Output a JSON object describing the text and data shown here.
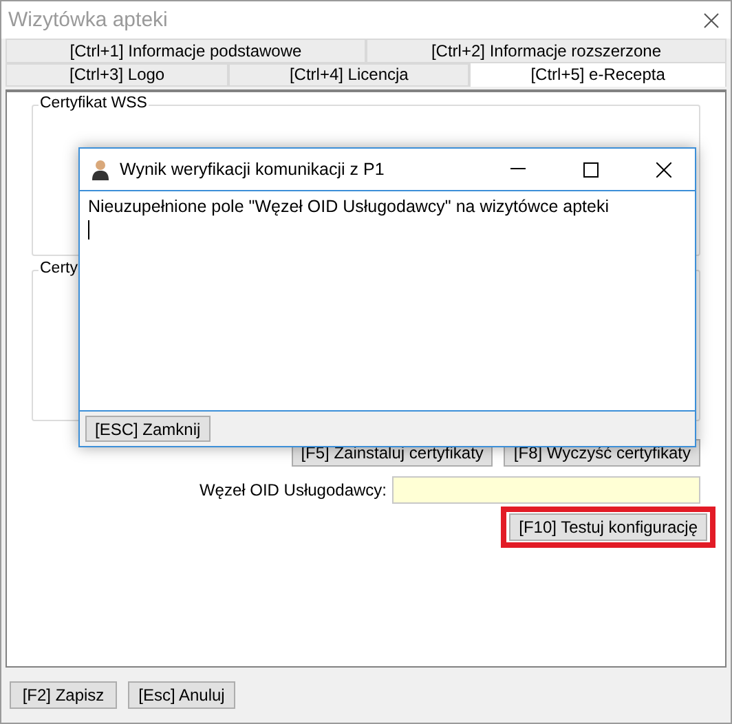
{
  "window": {
    "title": "Wizytówka apteki"
  },
  "tab_rows": [
    [
      {
        "label": "[Ctrl+1] Informacje podstawowe",
        "selected": false
      },
      {
        "label": "[Ctrl+2] Informacje rozszerzone",
        "selected": false
      }
    ],
    [
      {
        "label": "[Ctrl+3] Logo",
        "selected": false
      },
      {
        "label": "[Ctrl+4] Licencja",
        "selected": false
      },
      {
        "label": "[Ctrl+5] e-Recepta",
        "selected": true
      }
    ]
  ],
  "groups": [
    {
      "title": "Certyfikat WSS"
    },
    {
      "title": "Certy"
    }
  ],
  "certificate_buttons": [
    "[F5] Zainstaluj certyfikaty",
    "[F8] Wyczyść certyfikaty"
  ],
  "oid_field": {
    "label": "Węzeł OID Usługodawcy:"
  },
  "test_button": {
    "label": "[F10] Testuj konfigurację",
    "highlighted": true
  },
  "footer_buttons": [
    "[F2] Zapisz",
    "[Esc] Anuluj"
  ],
  "dialog": {
    "title": "Wynik weryfikacji komunikacji z P1",
    "message": "Nieuzupełnione pole \"Węzeł OID Usługodawcy\" na wizytówce apteki",
    "buttons": [
      "[ESC] Zamknij"
    ]
  }
}
